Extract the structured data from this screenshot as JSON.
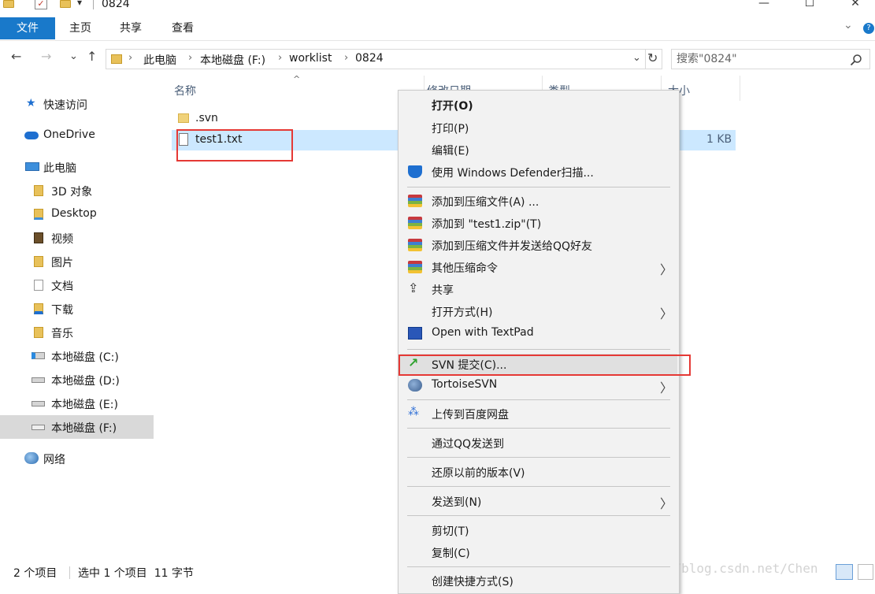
{
  "window": {
    "title": "0824",
    "minimize_glyph": "—",
    "maximize_glyph": "☐",
    "close_glyph": "✕"
  },
  "ribbon": {
    "tabs": [
      "文件",
      "主页",
      "共享",
      "查看"
    ],
    "expand_glyph": "⌄",
    "help_glyph": "?"
  },
  "address": {
    "crumbs": [
      "此电脑",
      "本地磁盘 (F:)",
      "worklist",
      "0824"
    ],
    "back_glyph": "←",
    "forward_glyph": "→",
    "recent_glyph": "⌄",
    "up_glyph": "↑",
    "dropdown_glyph": "⌄",
    "refresh_glyph": "↻"
  },
  "search": {
    "placeholder": "搜索\"0824\"",
    "icon": "search-icon"
  },
  "nav": {
    "items": [
      {
        "label": "快速访问",
        "icon": "star-icon"
      },
      {
        "label": "OneDrive",
        "icon": "cloud-icon"
      },
      {
        "label": "此电脑",
        "icon": "computer-icon"
      },
      {
        "label": "3D 对象",
        "icon": "folder-3d-icon"
      },
      {
        "label": "Desktop",
        "icon": "desktop-folder-icon"
      },
      {
        "label": "视频",
        "icon": "video-folder-icon"
      },
      {
        "label": "图片",
        "icon": "pictures-folder-icon"
      },
      {
        "label": "文档",
        "icon": "documents-folder-icon"
      },
      {
        "label": "下载",
        "icon": "downloads-folder-icon"
      },
      {
        "label": "音乐",
        "icon": "music-folder-icon"
      },
      {
        "label": "本地磁盘 (C:)",
        "icon": "system-drive-icon"
      },
      {
        "label": "本地磁盘 (D:)",
        "icon": "drive-icon"
      },
      {
        "label": "本地磁盘 (E:)",
        "icon": "drive-icon"
      },
      {
        "label": "本地磁盘 (F:)",
        "icon": "drive-icon"
      },
      {
        "label": "网络",
        "icon": "network-icon"
      }
    ]
  },
  "filelist": {
    "columns": [
      "名称",
      "修改日期",
      "类型",
      "大小"
    ],
    "sort_glyph": "^",
    "rows": [
      {
        "name": ".svn",
        "size": "",
        "icon": "folder-icon"
      },
      {
        "name": "test1.txt",
        "size": "1 KB",
        "icon": "text-file-icon"
      }
    ]
  },
  "status": {
    "item_count": "2 个项目",
    "selection": "选中 1 个项目  11 字节"
  },
  "watermark": "https://blog.csdn.net/Chen",
  "context_menu": {
    "submenu_glyph": "〉",
    "items": [
      {
        "label": "打开(O)",
        "icon": ""
      },
      {
        "label": "打印(P)",
        "icon": ""
      },
      {
        "label": "编辑(E)",
        "icon": ""
      },
      {
        "label": "使用 Windows Defender扫描...",
        "icon": "defender-shield-icon"
      },
      {
        "label": "添加到压缩文件(A) ...",
        "icon": "winrar-icon"
      },
      {
        "label": "添加到 \"test1.zip\"(T)",
        "icon": "winrar-icon"
      },
      {
        "label": "添加到压缩文件并发送给QQ好友",
        "icon": "winrar-icon"
      },
      {
        "label": "其他压缩命令",
        "icon": "winrar-icon"
      },
      {
        "label": "共享",
        "icon": "share-icon"
      },
      {
        "label": "打开方式(H)",
        "icon": ""
      },
      {
        "label": "Open with TextPad",
        "icon": "textpad-icon"
      },
      {
        "label": "SVN 提交(C)...",
        "icon": "svn-commit-icon"
      },
      {
        "label": "TortoiseSVN",
        "icon": "tortoisesvn-icon"
      },
      {
        "label": "上传到百度网盘",
        "icon": "baidu-netdisk-icon"
      },
      {
        "label": "通过QQ发送到",
        "icon": ""
      },
      {
        "label": "还原以前的版本(V)",
        "icon": ""
      },
      {
        "label": "发送到(N)",
        "icon": ""
      },
      {
        "label": "剪切(T)",
        "icon": ""
      },
      {
        "label": "复制(C)",
        "icon": ""
      },
      {
        "label": "创建快捷方式(S)",
        "icon": ""
      }
    ]
  }
}
